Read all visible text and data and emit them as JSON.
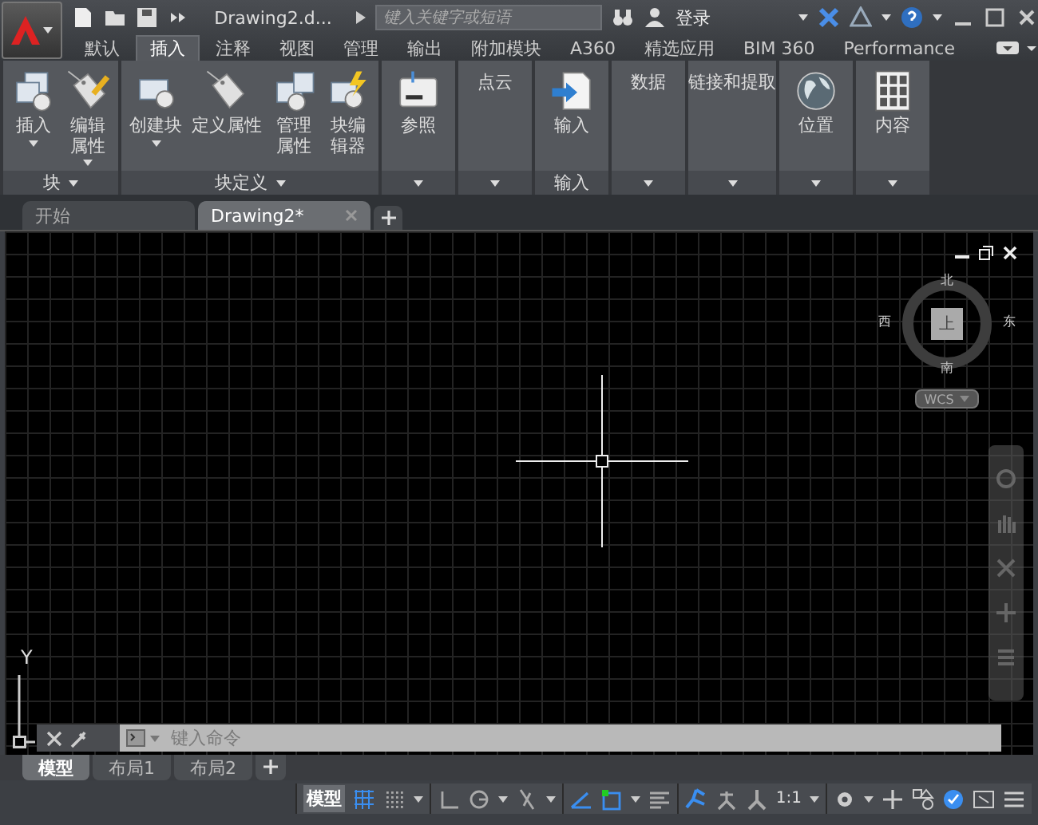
{
  "title_bar": {
    "title": "Drawing2.d...",
    "search": {
      "placeholder": "键入关键字或短语"
    },
    "login": "登录"
  },
  "ribbon_tabs": [
    {
      "label": "默认",
      "selected": false
    },
    {
      "label": "插入",
      "selected": true
    },
    {
      "label": "注释",
      "selected": false
    },
    {
      "label": "视图",
      "selected": false
    },
    {
      "label": "管理",
      "selected": false
    },
    {
      "label": "输出",
      "selected": false
    },
    {
      "label": "附加模块",
      "selected": false
    },
    {
      "label": "A360",
      "selected": false
    },
    {
      "label": "精选应用",
      "selected": false
    },
    {
      "label": "BIM 360",
      "selected": false
    },
    {
      "label": "Performance",
      "selected": false
    }
  ],
  "ribbon_panels": [
    {
      "title": "块",
      "title_dropdown": true,
      "expander": false,
      "buttons": [
        {
          "label": "插入",
          "dropdown": true,
          "stacked": false
        },
        {
          "label": "编辑属性",
          "dropdown": true,
          "stacked": true
        }
      ]
    },
    {
      "title": "块定义",
      "title_dropdown": true,
      "expander": false,
      "buttons": [
        {
          "label": "创建块",
          "dropdown": true,
          "stacked": false
        },
        {
          "label": "定义属性",
          "dropdown": false,
          "stacked": false
        },
        {
          "label": "管理属性",
          "dropdown": false,
          "stacked": true
        },
        {
          "label": "块编辑器",
          "dropdown": false,
          "stacked": true
        }
      ]
    },
    {
      "expander": true,
      "buttons": [
        {
          "label": "参照",
          "dropdown": false
        }
      ]
    },
    {
      "header": "点云",
      "expander": true
    },
    {
      "title": "输入",
      "title_dropdown": false,
      "expander": false,
      "buttons": [
        {
          "label": "输入",
          "dropdown": false
        }
      ]
    },
    {
      "header": "数据",
      "expander": true
    },
    {
      "header": "链接和提取",
      "expander": true
    },
    {
      "expander": true,
      "buttons": [
        {
          "label": "位置",
          "dropdown": false
        }
      ]
    },
    {
      "expander": true,
      "buttons": [
        {
          "label": "内容",
          "dropdown": false
        }
      ]
    }
  ],
  "file_tabs": [
    {
      "label": "开始",
      "selected": false,
      "closable": false
    },
    {
      "label": "Drawing2*",
      "selected": true,
      "closable": true
    }
  ],
  "viewcube": {
    "north": "北",
    "west": "西",
    "east": "东",
    "south": "南",
    "face": "上",
    "ucs": "WCS"
  },
  "ucs_axis": "Y",
  "command_line": {
    "placeholder": "键入命令"
  },
  "layout_tabs": [
    {
      "label": "模型",
      "selected": true
    },
    {
      "label": "布局1",
      "selected": false
    },
    {
      "label": "布局2",
      "selected": false
    }
  ],
  "status_bar": {
    "space": "模型",
    "scale": "1:1",
    "toggles": [
      {
        "on": true
      },
      {
        "on": false
      },
      {
        "on": false
      },
      {
        "on": false
      },
      {
        "on": false
      },
      {
        "on": true
      },
      {
        "on": true
      },
      {
        "on": false
      },
      {
        "on": true
      },
      {
        "on": false
      },
      {
        "on": false
      },
      {
        "on": true
      }
    ]
  }
}
